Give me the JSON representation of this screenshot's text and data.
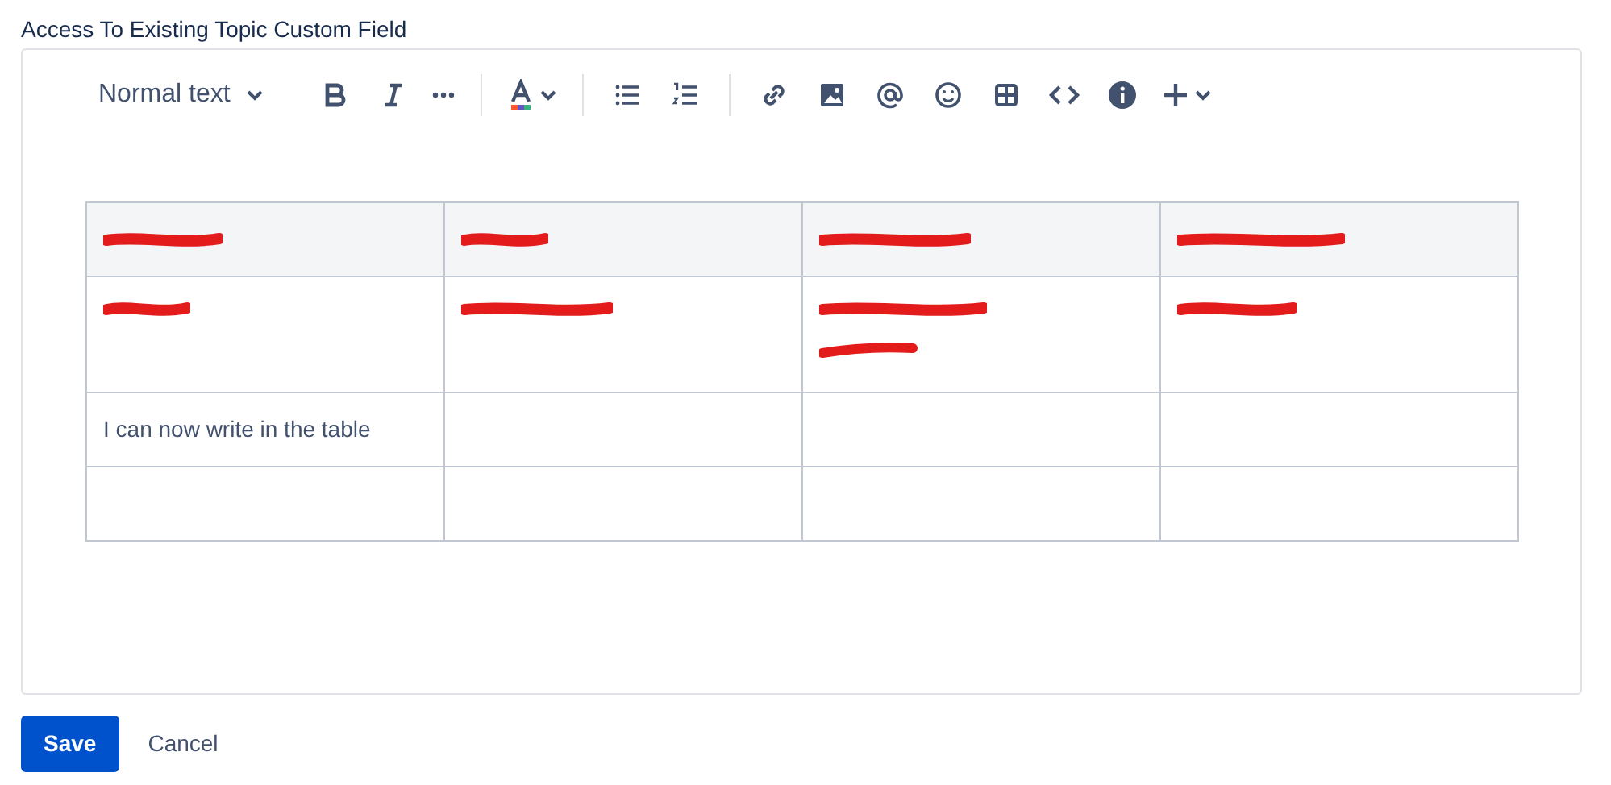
{
  "field_label": "Access To Existing Topic Custom Field",
  "toolbar": {
    "text_style": "Normal text",
    "tools": [
      {
        "kind": "bold"
      },
      {
        "kind": "italic"
      },
      {
        "kind": "more"
      },
      {
        "kind": "sep"
      },
      {
        "kind": "color"
      },
      {
        "kind": "sep"
      },
      {
        "kind": "bullets"
      },
      {
        "kind": "numbers"
      },
      {
        "kind": "sep"
      },
      {
        "kind": "link"
      },
      {
        "kind": "image"
      },
      {
        "kind": "mention"
      },
      {
        "kind": "emoji"
      },
      {
        "kind": "table"
      },
      {
        "kind": "code"
      },
      {
        "kind": "info"
      },
      {
        "kind": "insert"
      }
    ]
  },
  "table": {
    "header": [
      {
        "redacted": true
      },
      {
        "redacted": true
      },
      {
        "redacted": true
      },
      {
        "redacted": true
      }
    ],
    "rows": [
      [
        {
          "redacted": true
        },
        {
          "redacted": true
        },
        {
          "redacted": true,
          "wrapped": true
        },
        {
          "redacted": true
        }
      ],
      [
        {
          "text": "I can now write in the table"
        },
        {},
        {},
        {}
      ],
      [
        {},
        {},
        {},
        {}
      ]
    ]
  },
  "buttons": [
    {
      "label": "Save",
      "kind": "primary"
    },
    {
      "label": "Cancel",
      "kind": "subtle"
    }
  ]
}
